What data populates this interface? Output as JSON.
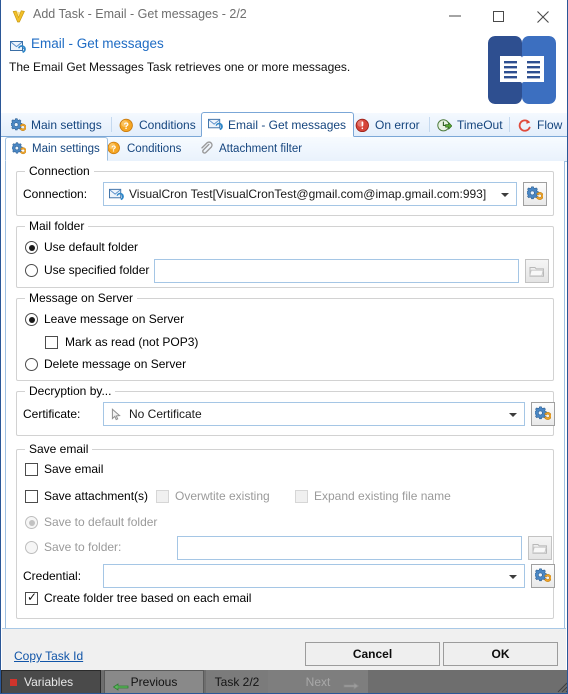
{
  "window": {
    "title": "Add Task - Email - Get messages - 2/2",
    "logo_icon": "visualcron-v-logo",
    "minimize_label": "Minimize",
    "maximize_label": "Maximize",
    "close_label": "Close"
  },
  "header": {
    "icon": "email-get-messages-icon",
    "title": "Email - Get messages",
    "description": "The Email Get Messages Task retrieves one or more messages.",
    "brand_icon": "book-logo",
    "brand_color_dark": "#2e4f90",
    "brand_color_light": "#3c6fc0"
  },
  "tabs_outer": [
    {
      "label": "Main settings",
      "icon": "gear-blue-icon",
      "selected": false
    },
    {
      "label": "Conditions",
      "icon": "question-orange-icon",
      "selected": false
    },
    {
      "label": "Email - Get messages",
      "icon": "email-get-messages-icon",
      "selected": true
    },
    {
      "label": "On error",
      "icon": "error-red-icon",
      "selected": false
    },
    {
      "label": "TimeOut",
      "icon": "timeout-green-icon",
      "selected": false
    },
    {
      "label": "Flow",
      "icon": "flow-red-icon",
      "selected": false
    }
  ],
  "tabs_inner": [
    {
      "label": "Main settings",
      "icon": "gear-blue-icon",
      "selected": true
    },
    {
      "label": "Conditions",
      "icon": "question-orange-icon",
      "selected": false
    },
    {
      "label": "Attachment filter",
      "icon": "paperclip-icon",
      "selected": false
    }
  ],
  "connection_group": {
    "title": "Connection",
    "label": "Connection:",
    "value": "VisualCron Test[VisualCronTest@gmail.com@imap.gmail.com:993]",
    "value_icon": "email-get-messages-icon",
    "settings_button": "gear-settings-button"
  },
  "mail_folder_group": {
    "title": "Mail folder",
    "use_default": {
      "label": "Use default folder",
      "checked": true
    },
    "use_specified": {
      "label": "Use specified folder",
      "checked": false
    },
    "folder_value": "",
    "folder_placeholder": "",
    "browse_button": "folder-browse-button",
    "browse_enabled": false
  },
  "message_on_server_group": {
    "title": "Message on Server",
    "leave": {
      "label": "Leave message on Server",
      "checked": true
    },
    "mark_as_read": {
      "label": "Mark as read (not POP3)",
      "checked": false
    },
    "delete": {
      "label": "Delete message on Server",
      "checked": false
    }
  },
  "decryption_group": {
    "title": "Decryption by...",
    "label": "Certificate:",
    "value": "No Certificate",
    "value_icon": "certificate-cursor-icon",
    "settings_button": "gear-settings-button"
  },
  "save_email_group": {
    "title": "Save email",
    "save_email": {
      "label": "Save email",
      "checked": false,
      "enabled": true
    },
    "save_attachments": {
      "label": "Save attachment(s)",
      "checked": false,
      "enabled": true
    },
    "overwrite_existing": {
      "label": "Overwtite existing",
      "checked": false,
      "enabled": false
    },
    "expand_existing": {
      "label": "Expand existing file name",
      "checked": false,
      "enabled": false
    },
    "save_to_default": {
      "label": "Save to default folder",
      "checked": true,
      "enabled": false
    },
    "save_to_folder": {
      "label": "Save to folder:",
      "checked": false,
      "enabled": false
    },
    "save_to_folder_value": "",
    "browse_button": "folder-browse-button",
    "credential_label": "Credential:",
    "credential_value": "",
    "credential_settings_button": "gear-settings-button",
    "create_folder_tree": {
      "label": "Create folder tree based on each email",
      "checked": true,
      "enabled": true
    }
  },
  "footer": {
    "copy_task_id": "Copy Task Id",
    "cancel": "Cancel",
    "ok": "OK"
  },
  "taskbar": {
    "variables": "Variables",
    "previous": "Previous",
    "task_counter": "Task 2/2",
    "next": "Next",
    "variables_dot_color": "#d0342c",
    "previous_arrow_color": "#3f9e3f",
    "next_arrow_color": "#a8a8a8"
  }
}
